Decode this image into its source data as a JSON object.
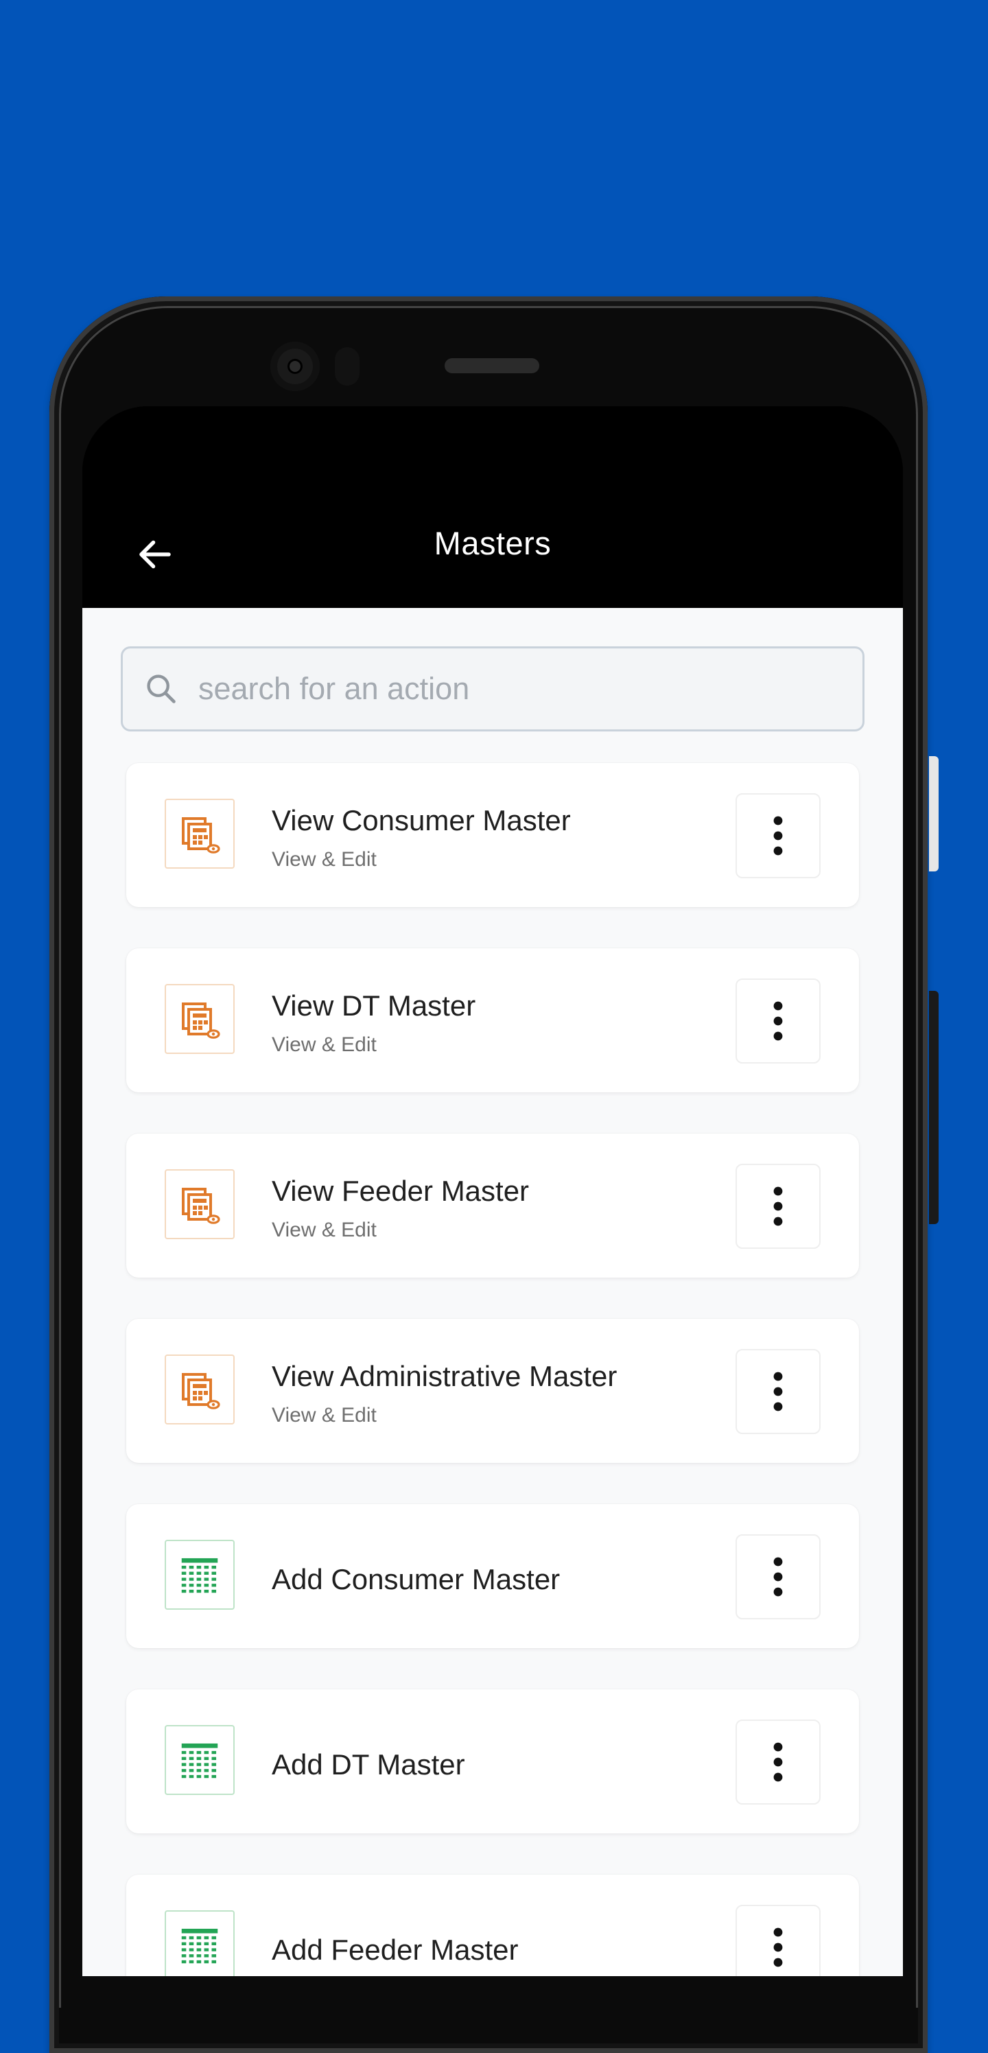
{
  "header": {
    "title": "Masters"
  },
  "search": {
    "placeholder": "search for an action"
  },
  "items": [
    {
      "title": "View Consumer Master",
      "subtitle": "View & Edit",
      "icon": "calculator-eye-icon"
    },
    {
      "title": "View DT Master",
      "subtitle": "View & Edit",
      "icon": "calculator-eye-icon"
    },
    {
      "title": "View Feeder Master",
      "subtitle": "View & Edit",
      "icon": "calculator-eye-icon"
    },
    {
      "title": "View Administrative Master",
      "subtitle": "View & Edit",
      "icon": "calculator-eye-icon"
    },
    {
      "title": "Add Consumer Master",
      "icon": "spreadsheet-grid-icon"
    },
    {
      "title": "Add DT Master",
      "icon": "spreadsheet-grid-icon"
    },
    {
      "title": "Add Feeder Master",
      "icon": "spreadsheet-grid-icon"
    }
  ],
  "colors": {
    "background": "#0254B8",
    "view_icon": "#E07A2A",
    "add_icon": "#23A455"
  }
}
